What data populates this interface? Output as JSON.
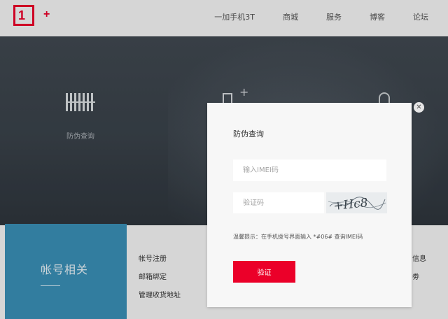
{
  "header": {
    "logo_text": "1",
    "logo_plus": "+",
    "nav": [
      "一加手机3T",
      "商城",
      "服务",
      "博客",
      "论坛"
    ]
  },
  "hero": {
    "features": [
      {
        "label": "防伪查询",
        "icon": "barcode-icon"
      },
      {
        "label": "",
        "icon": "phone-plus-icon"
      },
      {
        "label": "",
        "icon": "lock-icon"
      }
    ]
  },
  "account_section": {
    "title": "帐号相关",
    "links": [
      "帐号注册",
      "邮箱绑定",
      "管理收货地址"
    ],
    "right_links": [
      "信息",
      "劵"
    ]
  },
  "modal": {
    "title": "防伪查询",
    "imei_placeholder": "输入IMEI码",
    "captcha_placeholder": "验证码",
    "captcha_text": "+Hc8",
    "hint": "温馨提示：在手机拨号界面输入 *#06# 查询IMEI码",
    "verify_label": "验证",
    "close_icon": "close-icon"
  },
  "colors": {
    "brand_red": "#eb0029",
    "account_blue": "#3a8fb5"
  }
}
